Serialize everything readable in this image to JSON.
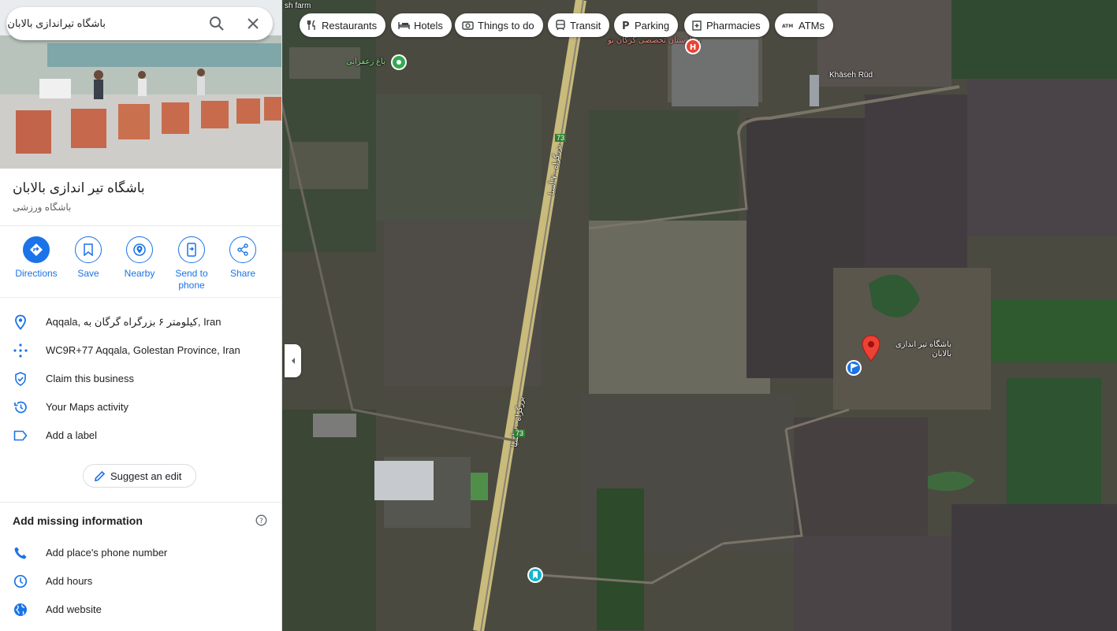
{
  "search": {
    "query": "باشگاه تیراندازی بالابان",
    "icons": [
      "search-icon",
      "close-icon"
    ]
  },
  "place": {
    "title": "باشگاه تیر اندازی بالابان",
    "category": "باشگاه ورزشی"
  },
  "actions": [
    {
      "label": "Directions",
      "icon": "directions-icon"
    },
    {
      "label": "Save",
      "icon": "bookmark-icon"
    },
    {
      "label": "Nearby",
      "icon": "nearby-icon"
    },
    {
      "label": "Send to phone",
      "icon": "send-to-phone-icon"
    },
    {
      "label": "Share",
      "icon": "share-icon"
    }
  ],
  "info": {
    "address": "Aqqala, کیلومتر ۶ بزرگراه گرگان به, Iran",
    "plus_code": "WC9R+77 Aqqala, Golestan Province, Iran",
    "claim": "Claim this business",
    "maps_activity": "Your Maps activity",
    "add_label": "Add a label"
  },
  "suggest_edit": "Suggest an edit",
  "missing": {
    "heading": "Add missing information",
    "items": [
      "Add place's phone number",
      "Add hours",
      "Add website"
    ]
  },
  "chips": [
    "Restaurants",
    "Hotels",
    "Things to do",
    "Transit",
    "Parking",
    "Pharmacies",
    "ATMs"
  ],
  "map_labels": {
    "top_left": "sh farm",
    "garden": "باغ زعفرانی",
    "hospital": "بیمارستان تخصصی گرگان نو",
    "river": "Khāseh Rūd",
    "place_pin": "باشگاه تیر اندازی بالابان",
    "highway": "بزرگراه ۷۰ آسیا",
    "road_shield": "73"
  },
  "colors": {
    "accent": "#1a73e8",
    "pin_red": "#ea4335",
    "garden_green": "#34a853",
    "transit_teal": "#12b5cb"
  }
}
